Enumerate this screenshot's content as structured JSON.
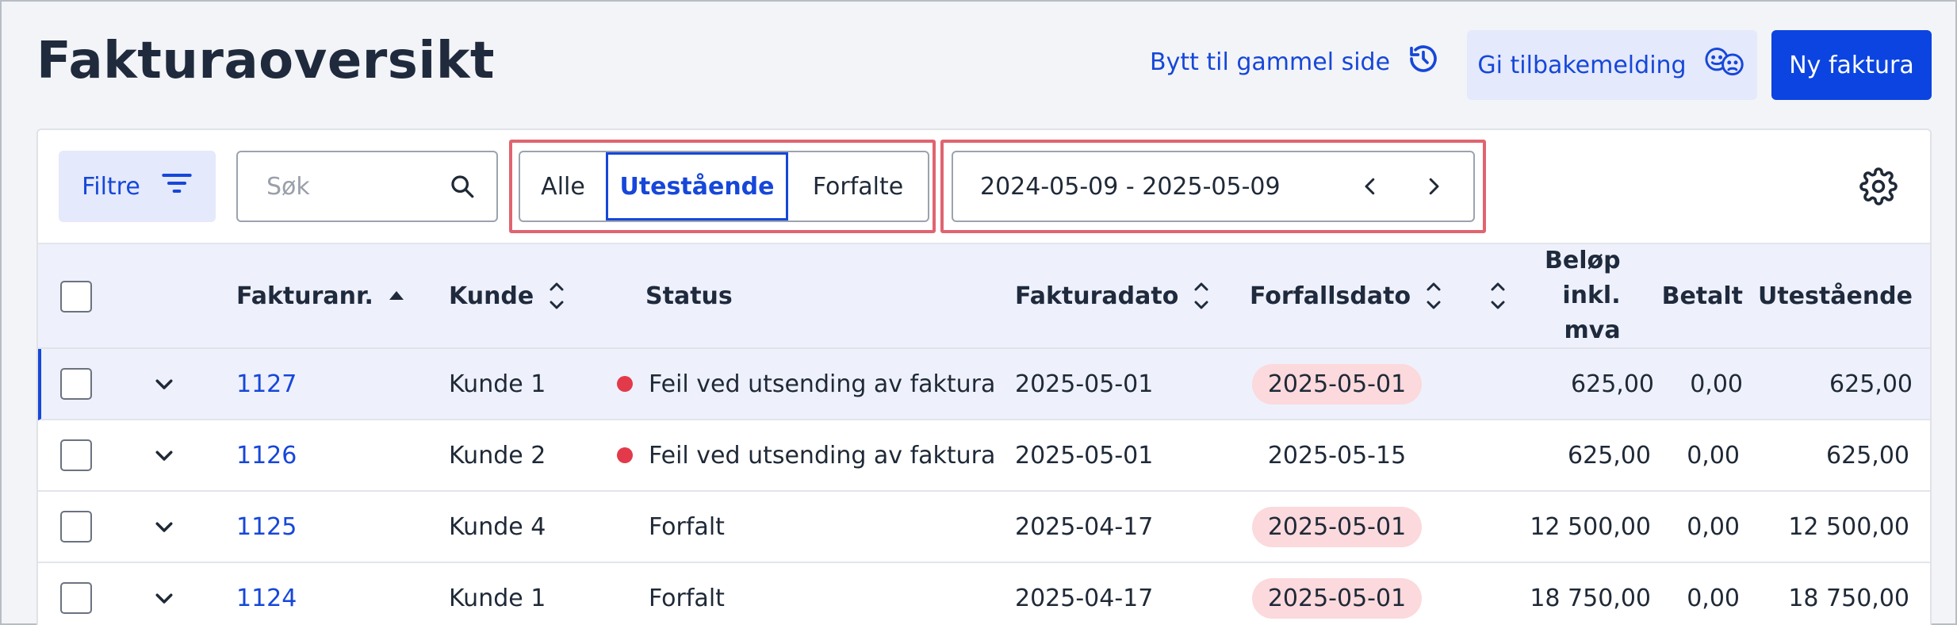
{
  "header": {
    "title": "Fakturaoversikt",
    "switch_link": "Bytt til gammel side",
    "feedback_button": "Gi tilbakemelding",
    "new_button": "Ny faktura"
  },
  "toolbar": {
    "filter_label": "Filtre",
    "search_placeholder": "Søk",
    "segments": [
      "Alle",
      "Utestående",
      "Forfalte"
    ],
    "active_segment": "Utestående",
    "date_range": "2024-05-09 - 2025-05-09"
  },
  "table": {
    "columns": {
      "invoice_no": "Fakturanr.",
      "customer": "Kunde",
      "status": "Status",
      "invoice_date": "Fakturadato",
      "due_date": "Forfallsdato",
      "amount": [
        "Beløp",
        "inkl.",
        "mva"
      ],
      "paid": "Betalt",
      "outstanding": "Utestående"
    },
    "rows": [
      {
        "invoice_no": "1127",
        "customer": "Kunde 1",
        "status": "Feil ved utsending av faktura",
        "status_error": true,
        "invoice_date": "2025-05-01",
        "due_date": "2025-05-01",
        "overdue": true,
        "amount": "625,00",
        "paid": "0,00",
        "outstanding": "625,00"
      },
      {
        "invoice_no": "1126",
        "customer": "Kunde 2",
        "status": "Feil ved utsending av faktura",
        "status_error": true,
        "invoice_date": "2025-05-01",
        "due_date": "2025-05-15",
        "overdue": false,
        "amount": "625,00",
        "paid": "0,00",
        "outstanding": "625,00"
      },
      {
        "invoice_no": "1125",
        "customer": "Kunde 4",
        "status": "Forfalt",
        "status_error": false,
        "invoice_date": "2025-04-17",
        "due_date": "2025-05-01",
        "overdue": true,
        "amount": "12 500,00",
        "paid": "0,00",
        "outstanding": "12 500,00"
      },
      {
        "invoice_no": "1124",
        "customer": "Kunde 1",
        "status": "Forfalt",
        "status_error": false,
        "invoice_date": "2025-04-17",
        "due_date": "2025-05-01",
        "overdue": true,
        "amount": "18 750,00",
        "paid": "0,00",
        "outstanding": "18 750,00"
      }
    ]
  },
  "colors": {
    "accent": "#1647d9",
    "primary_button": "#0b44e0",
    "overdue_pill": "#fbd9dc",
    "error_dot": "#e23a4a",
    "highlight_outline": "#e06470"
  }
}
